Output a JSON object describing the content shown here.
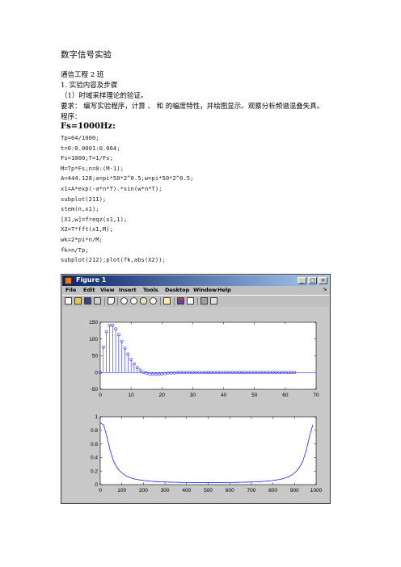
{
  "doc": {
    "title": "数字信号实验",
    "class_line": "通信工程 2 班",
    "section": "1.   实验内容及步骤",
    "subsection": "（1）时域采样理论的验证。",
    "requirement": "要求：   编写实验程序，计算  、   和  的幅度特性，并绘图显示。观察分析频谱混叠失真。",
    "program_label": "程序：",
    "case_heading": "Fs=1000Hz:",
    "code": [
      "Tp=64/1000;",
      "t=0:0.0001:0.064;",
      "Fs=1000;T=1/Fs;",
      "M=Tp*Fs;n=0:(M-1);",
      "A=444.128;a=pi*50*2^0.5;w=pi*50*2^0.5;",
      "x1=A*exp(-a*n*T).*sin(w*n*T);",
      "subplot(211);",
      "stem(n,x1);",
      "[X1,w]=freqz(x1,1);",
      "X2=T*fft(x1,M);",
      "wk=2*pi*n/M;",
      "fk=n/Tp;",
      "subplot(212);plot(fk,abs(X2));"
    ]
  },
  "figure_window": {
    "title": "Figure 1",
    "controls": [
      "_",
      "□",
      "×"
    ],
    "menu": [
      "File",
      "Edit",
      "View",
      "Insert",
      "Tools",
      "Desktop",
      "Window",
      "Help"
    ],
    "menu_arrow": "↘",
    "toolbar_icons": [
      "new-icon",
      "open-icon",
      "save-icon",
      "print-icon",
      "pointer-icon",
      "zoom-in-icon",
      "zoom-out-icon",
      "pan-icon",
      "rotate-icon",
      "data-cursor-icon",
      "colorbar-icon",
      "legend-icon",
      "hide-plot-tools-icon",
      "show-plot-tools-icon"
    ]
  },
  "chart_data": [
    {
      "type": "stem",
      "xlim": [
        0,
        70
      ],
      "ylim": [
        -50,
        150
      ],
      "xticks": [
        0,
        10,
        20,
        30,
        40,
        50,
        60,
        70
      ],
      "yticks": [
        -50,
        0,
        50,
        100,
        150
      ],
      "color": "#0000ff",
      "x": [
        0,
        1,
        2,
        3,
        4,
        5,
        6,
        7,
        8,
        9,
        10,
        11,
        12,
        13,
        14,
        15,
        16,
        17,
        18,
        19,
        20,
        21,
        22,
        23,
        24,
        25,
        26,
        27,
        28,
        29,
        30,
        31,
        32,
        33,
        34,
        35,
        36,
        37,
        38,
        39,
        40,
        41,
        42,
        43,
        44,
        45,
        46,
        47,
        48,
        49,
        50,
        51,
        52,
        53,
        54,
        55,
        56,
        57,
        58,
        59,
        60,
        61,
        62,
        63
      ],
      "values": [
        0,
        76,
        122,
        141,
        141,
        130,
        113,
        93,
        73,
        55,
        39,
        26,
        15,
        7,
        1,
        -2,
        -4,
        -5,
        -5,
        -5,
        -4,
        -3,
        -2,
        -1,
        -1,
        0,
        0,
        0,
        0,
        0,
        0,
        0,
        0,
        0,
        0,
        0,
        0,
        0,
        0,
        0,
        0,
        0,
        0,
        0,
        0,
        0,
        0,
        0,
        0,
        0,
        0,
        0,
        0,
        0,
        0,
        0,
        0,
        0,
        0,
        0,
        0,
        0,
        0,
        0
      ]
    },
    {
      "type": "line",
      "xlim": [
        0,
        1000
      ],
      "ylim": [
        0,
        1
      ],
      "xticks": [
        0,
        100,
        200,
        300,
        400,
        500,
        600,
        700,
        800,
        900,
        1000
      ],
      "yticks": [
        0,
        0.2,
        0.4,
        0.6,
        0.8,
        1
      ],
      "color": "#0000ff",
      "x": [
        0,
        15.6,
        31.3,
        46.9,
        62.5,
        78.1,
        93.8,
        109.4,
        125,
        140.6,
        156.3,
        171.9,
        187.5,
        203.1,
        218.8,
        234.4,
        250,
        265.6,
        281.3,
        296.9,
        312.5,
        328.1,
        343.8,
        359.4,
        375,
        390.6,
        406.3,
        421.9,
        437.5,
        453.1,
        468.8,
        484.4,
        500,
        515.6,
        531.3,
        546.9,
        562.5,
        578.1,
        593.8,
        609.4,
        625,
        640.6,
        656.3,
        671.9,
        687.5,
        703.1,
        718.8,
        734.4,
        750,
        765.6,
        781.3,
        796.9,
        812.5,
        828.1,
        843.8,
        859.4,
        875,
        890.6,
        906.3,
        921.9,
        937.5,
        953.1,
        968.8,
        984.4
      ],
      "y": [
        0.91,
        0.88,
        0.7,
        0.49,
        0.34,
        0.25,
        0.19,
        0.15,
        0.12,
        0.1,
        0.085,
        0.075,
        0.067,
        0.06,
        0.055,
        0.05,
        0.046,
        0.043,
        0.041,
        0.039,
        0.037,
        0.036,
        0.035,
        0.034,
        0.033,
        0.032,
        0.032,
        0.031,
        0.031,
        0.031,
        0.03,
        0.03,
        0.03,
        0.03,
        0.03,
        0.031,
        0.031,
        0.031,
        0.032,
        0.032,
        0.033,
        0.034,
        0.035,
        0.036,
        0.037,
        0.039,
        0.041,
        0.043,
        0.046,
        0.05,
        0.055,
        0.06,
        0.067,
        0.075,
        0.085,
        0.1,
        0.12,
        0.15,
        0.19,
        0.25,
        0.34,
        0.49,
        0.7,
        0.88
      ]
    }
  ]
}
